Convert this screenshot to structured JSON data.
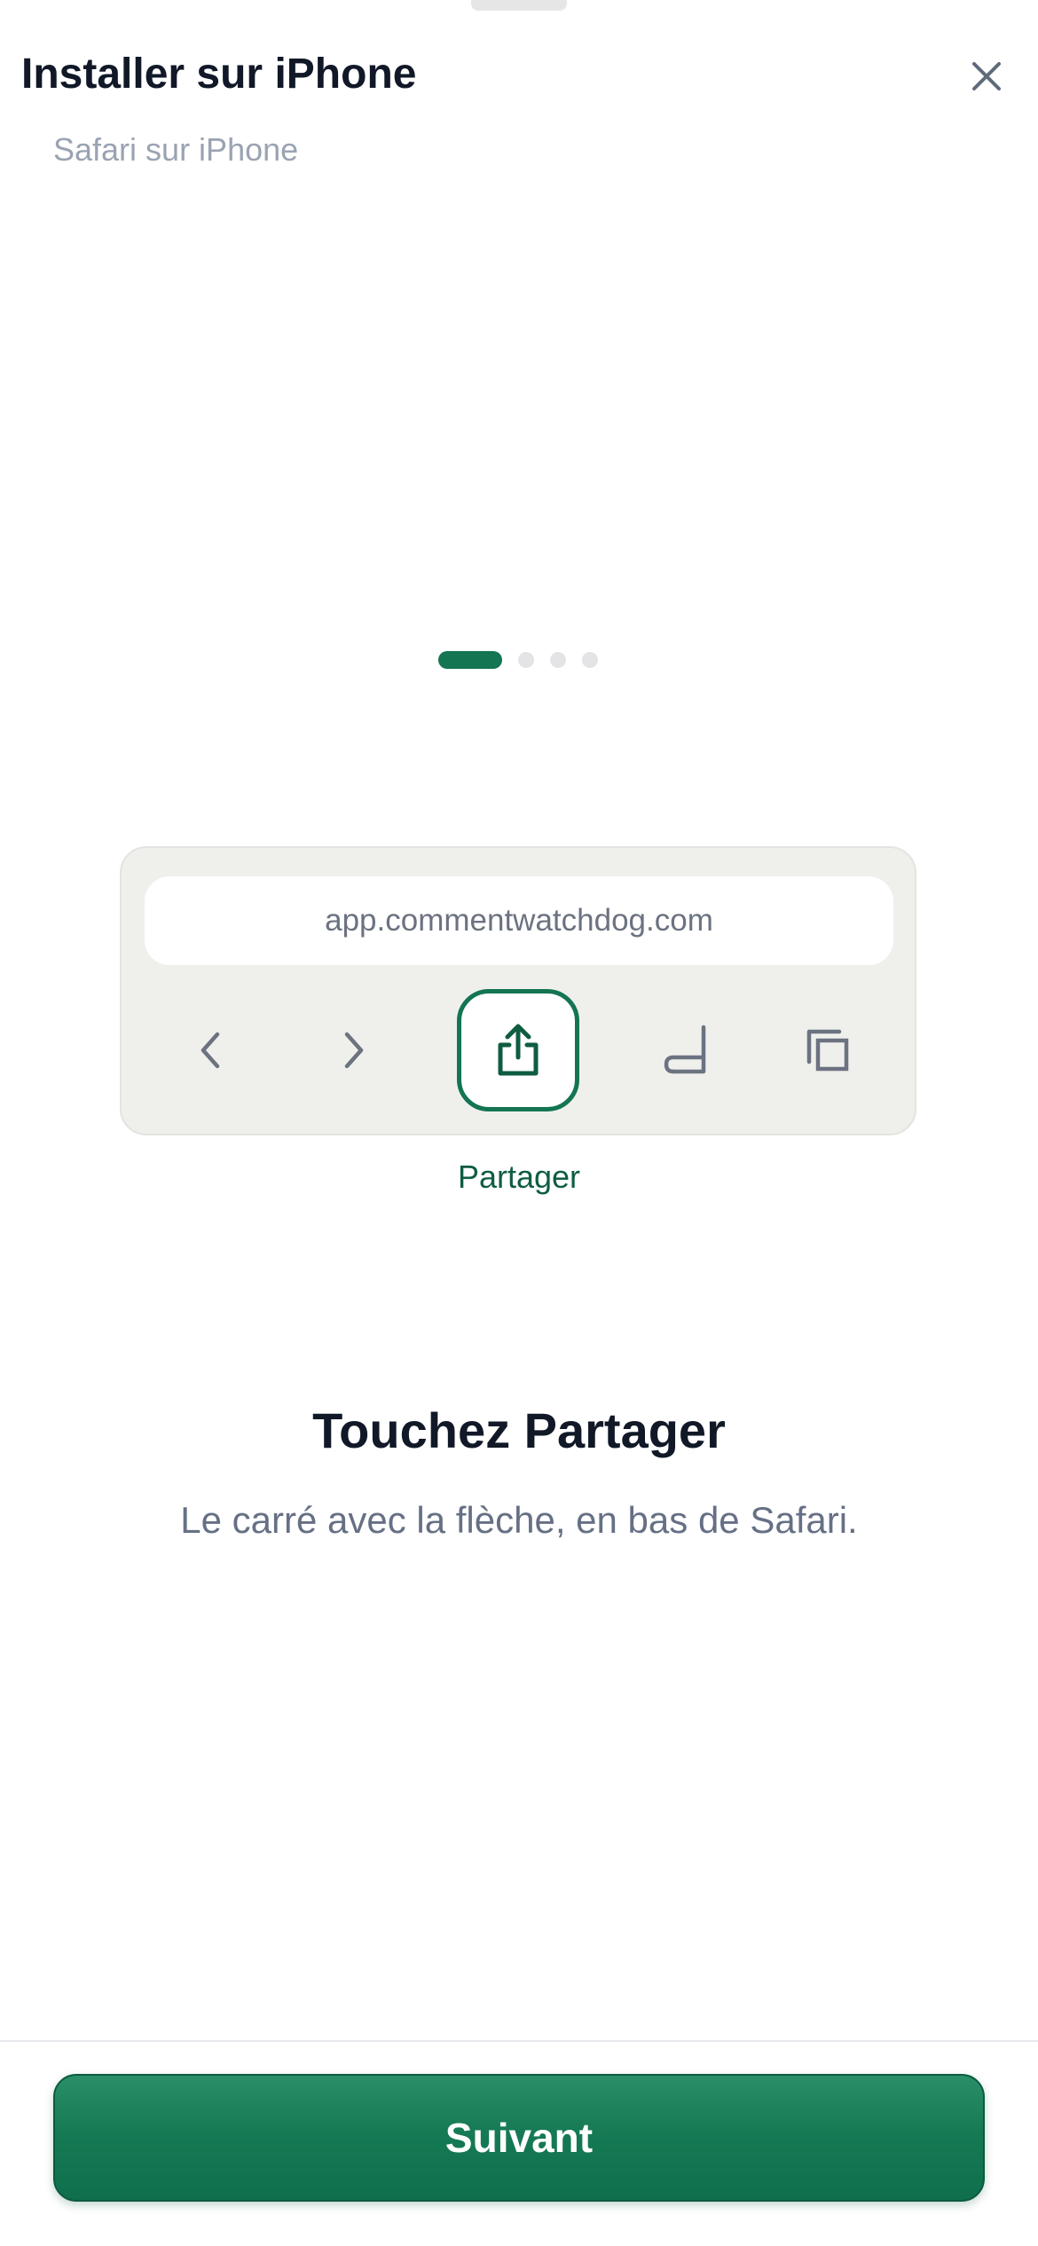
{
  "sheet": {
    "title": "Installer sur iPhone",
    "subtitle": "Safari sur iPhone"
  },
  "carousel": {
    "total_steps": 4,
    "current_step": 1
  },
  "browser_mock": {
    "url": "app.commentwatchdog.com",
    "toolbar_icons": [
      "chevron-left-icon",
      "chevron-right-icon",
      "share-icon",
      "bookmarks-icon",
      "tabs-icon"
    ],
    "highlighted_icon": "share-icon",
    "highlight_label": "Partager"
  },
  "step": {
    "title": "Touchez Partager",
    "description": "Le carré avec la flèche, en bas de Safari."
  },
  "footer": {
    "next_label": "Suivant"
  },
  "colors": {
    "accent": "#137552",
    "accent_dark": "#0f5d40",
    "title_text": "#111827",
    "muted_text": "#9aa3b2",
    "body_text": "#667085",
    "mock_background": "#eff0ec",
    "icon_gray": "#6b7280"
  }
}
